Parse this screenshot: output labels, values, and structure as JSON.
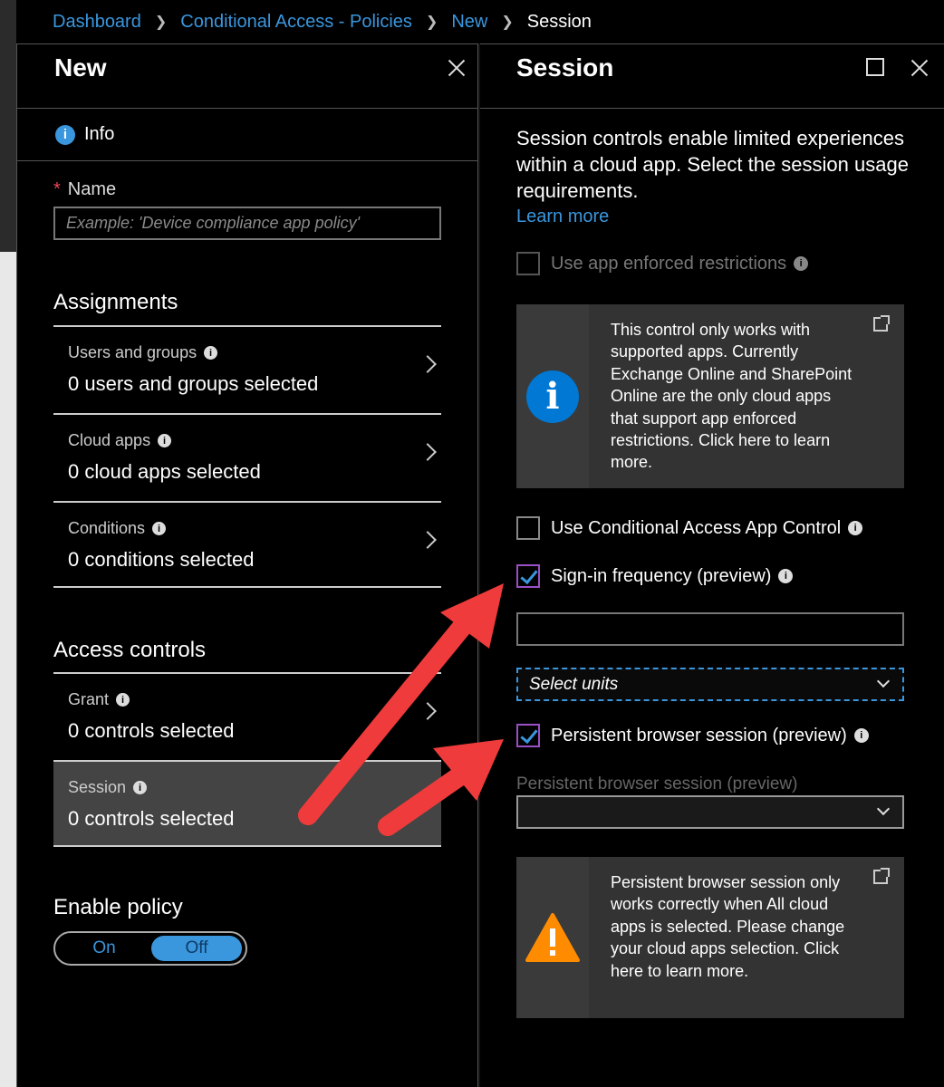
{
  "breadcrumb": {
    "items": [
      "Dashboard",
      "Conditional Access - Policies",
      "New"
    ],
    "current": "Session"
  },
  "new_blade": {
    "title": "New",
    "info_label": "Info",
    "name_label": "Name",
    "name_required": "*",
    "name_placeholder": "Example: 'Device compliance app policy'",
    "assignments_title": "Assignments",
    "assignments": [
      {
        "label": "Users and groups",
        "value": "0 users and groups selected"
      },
      {
        "label": "Cloud apps",
        "value": "0 cloud apps selected"
      },
      {
        "label": "Conditions",
        "value": "0 conditions selected"
      }
    ],
    "access_controls_title": "Access controls",
    "access_controls": [
      {
        "label": "Grant",
        "value": "0 controls selected"
      },
      {
        "label": "Session",
        "value": "0 controls selected"
      }
    ],
    "enable_policy_title": "Enable policy",
    "toggle": {
      "on": "On",
      "off": "Off",
      "selected": "Off"
    }
  },
  "session_blade": {
    "title": "Session",
    "description": "Session controls enable limited experiences within a cloud app. Select the session usage requirements.",
    "learn_more": "Learn more",
    "app_enforced": {
      "label": "Use app enforced restrictions",
      "checked": false,
      "disabled": true
    },
    "info_callout": "This control only works with supported apps. Currently Exchange Online and SharePoint Online are the only cloud apps that support app enforced restrictions. Click here to learn more.",
    "ca_app_control": {
      "label": "Use Conditional Access App Control",
      "checked": false
    },
    "signin_frequency": {
      "label": "Sign-in frequency (preview)",
      "checked": true,
      "value": ""
    },
    "units_select": {
      "value": "Select units"
    },
    "persistent": {
      "label": "Persistent browser session (preview)",
      "checked": true
    },
    "persistent_field_label": "Persistent browser session (preview)",
    "persistent_select": {
      "value": ""
    },
    "warning_callout": "Persistent browser session only works correctly when All cloud apps is selected. Please change your cloud apps selection. Click here to learn more."
  },
  "colors": {
    "accent": "#3a96dd",
    "warning": "#ff8c00",
    "annotation_arrow": "#ef3b3b"
  },
  "icons": {
    "info": "info-icon",
    "close": "close-icon",
    "maximize": "maximize-icon",
    "external": "external-link-icon",
    "warning": "warning-icon"
  }
}
